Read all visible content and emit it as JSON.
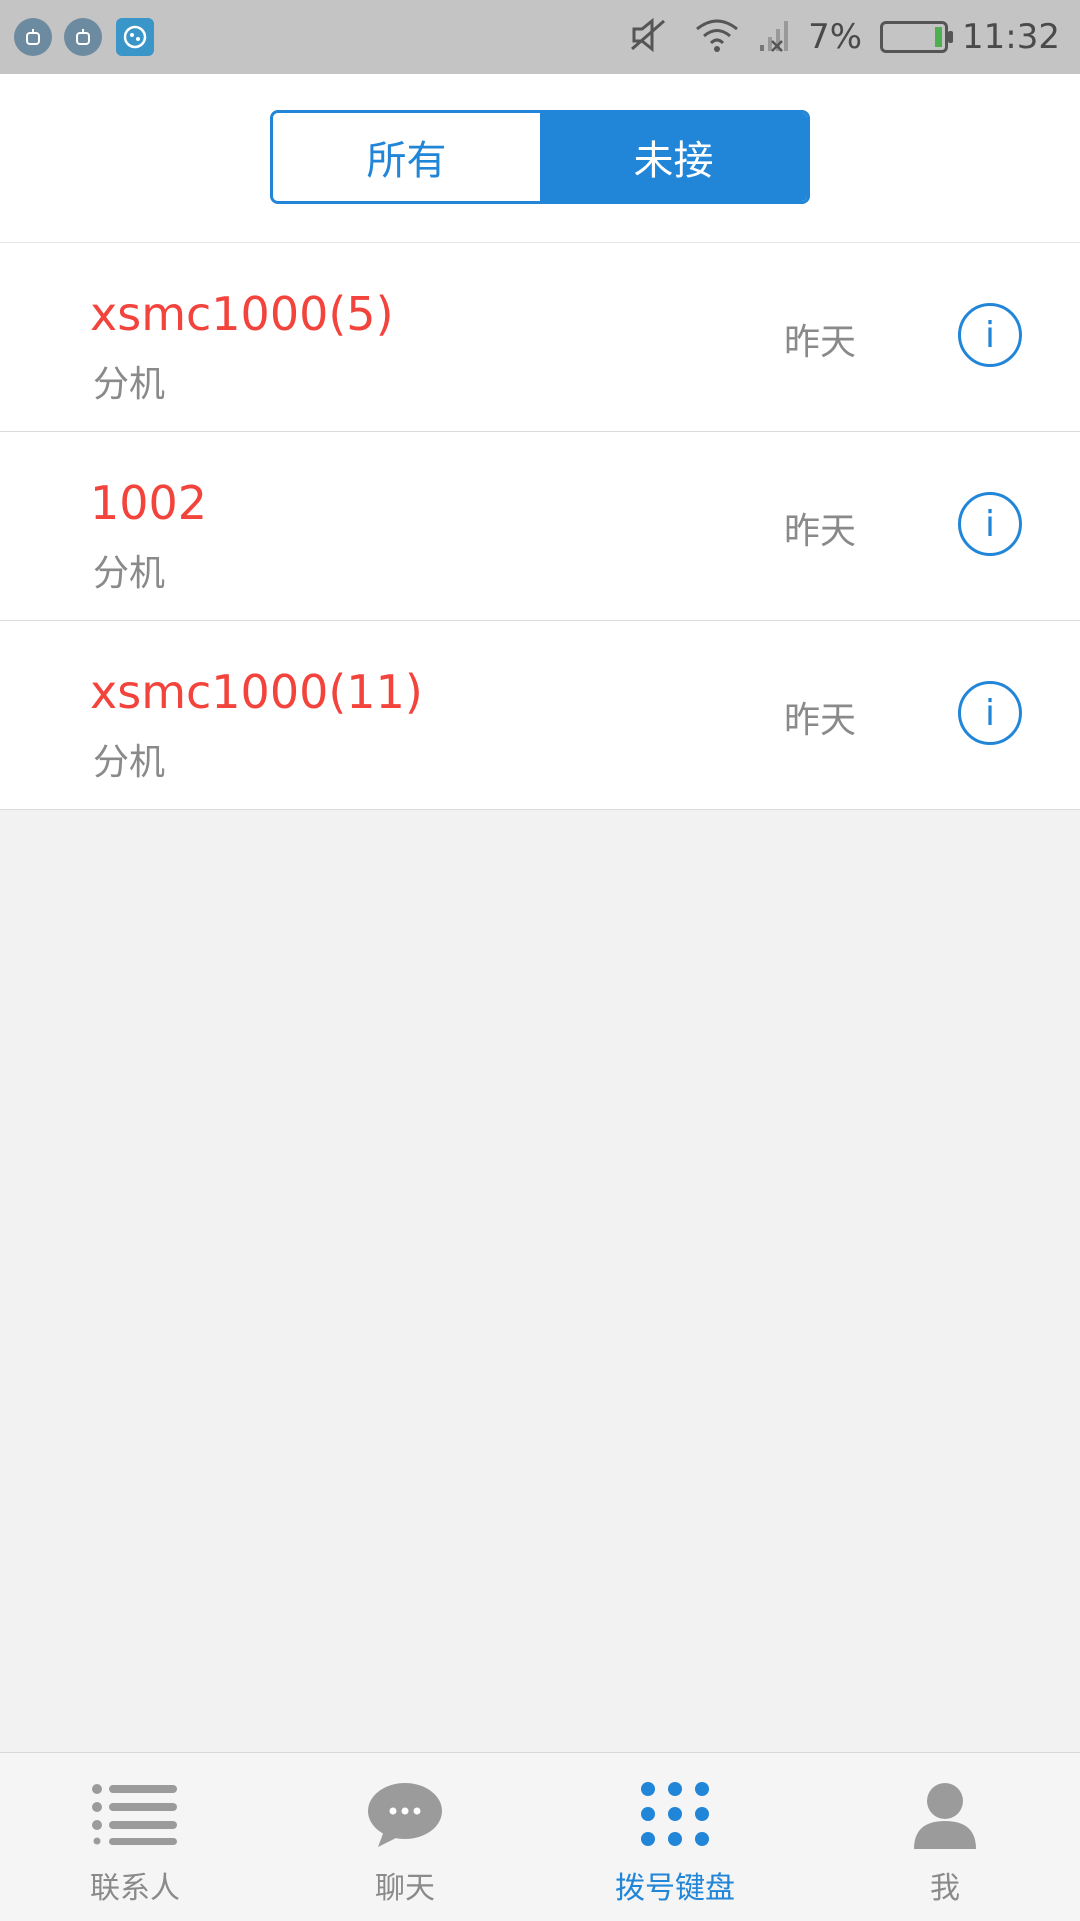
{
  "status_bar": {
    "battery": "7%",
    "time": "11:32"
  },
  "tabs": {
    "all": "所有",
    "missed": "未接",
    "selected": "missed"
  },
  "calls": [
    {
      "name": "xsmc1000(5)",
      "type": "分机",
      "date": "昨天"
    },
    {
      "name": "1002",
      "type": "分机",
      "date": "昨天"
    },
    {
      "name": "xsmc1000(11)",
      "type": "分机",
      "date": "昨天"
    }
  ],
  "bottom_nav": {
    "contacts": "联系人",
    "chat": "聊天",
    "dialpad": "拨号键盘",
    "me": "我",
    "active": "dialpad"
  },
  "colors": {
    "accent": "#2185d8",
    "missed_name": "#f2443c",
    "secondary_text": "#8a8a8a"
  }
}
